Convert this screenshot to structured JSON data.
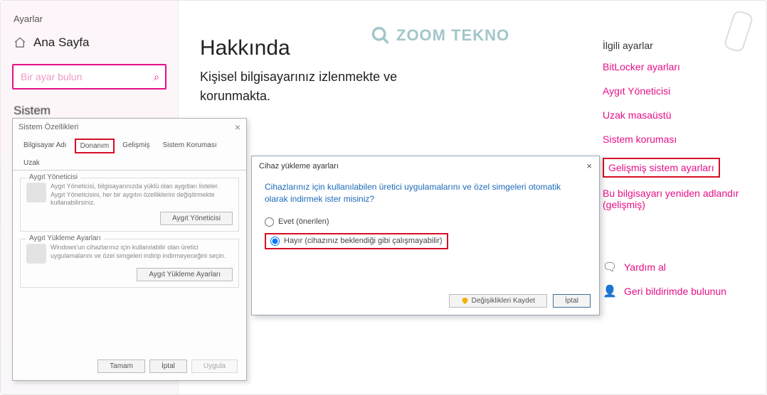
{
  "window": {
    "title": "Ayarlar"
  },
  "sidebar": {
    "home": "Ana Sayfa",
    "search_placeholder": "Bir ayar bulun",
    "section": "Sistem"
  },
  "main": {
    "heading": "Hakkında",
    "subtext": "Kişisel bilgisayarınız izlenmekte ve korunmakta."
  },
  "logo": "ZOOM TEKNO",
  "right": {
    "heading": "İlgili ayarlar",
    "links": [
      "BitLocker ayarları",
      "Aygıt Yöneticisi",
      "Uzak masaüstü",
      "Sistem koruması",
      "Gelişmiş sistem ayarları",
      "Bu bilgisayarı yeniden adlandır (gelişmiş)"
    ],
    "help": "Yardım al",
    "feedback": "Geri bildirimde bulunun"
  },
  "sysprops": {
    "title": "Sistem Özellikleri",
    "tabs": [
      "Bilgisayar Adı",
      "Donanım",
      "Gelişmiş",
      "Sistem Koruması",
      "Uzak"
    ],
    "group1": {
      "legend": "Aygıt Yöneticisi",
      "desc": "Aygıt Yöneticisi, bilgisayarınızda yüklü olan aygıtları listeler. Aygıt Yöneticisini, her bir aygıtın özelliklerini değiştirmekte kullanabilirsiniz.",
      "button": "Aygıt Yöneticisi"
    },
    "group2": {
      "legend": "Aygıt Yükleme Ayarları",
      "desc": "Windows'un cihazlarınız için kullanılabilir olan üretici uygulamalarını ve özel simgeleri indirip indirmeyeceğini seçin.",
      "button": "Aygıt Yükleme Ayarları"
    },
    "buttons": {
      "ok": "Tamam",
      "cancel": "İptal",
      "apply": "Uygula"
    }
  },
  "devdlg": {
    "title": "Cihaz yükleme ayarları",
    "question": "Cihazlarınız için kullanılabilen üretici uygulamalarını ve özel simgeleri otomatik olarak indirmek ister misiniz?",
    "option_yes": "Evet (önerilen)",
    "option_no": "Hayır (cihazınız beklendiği gibi çalışmayabilir)",
    "save": "Değişiklikleri Kaydet",
    "cancel": "İptal"
  }
}
